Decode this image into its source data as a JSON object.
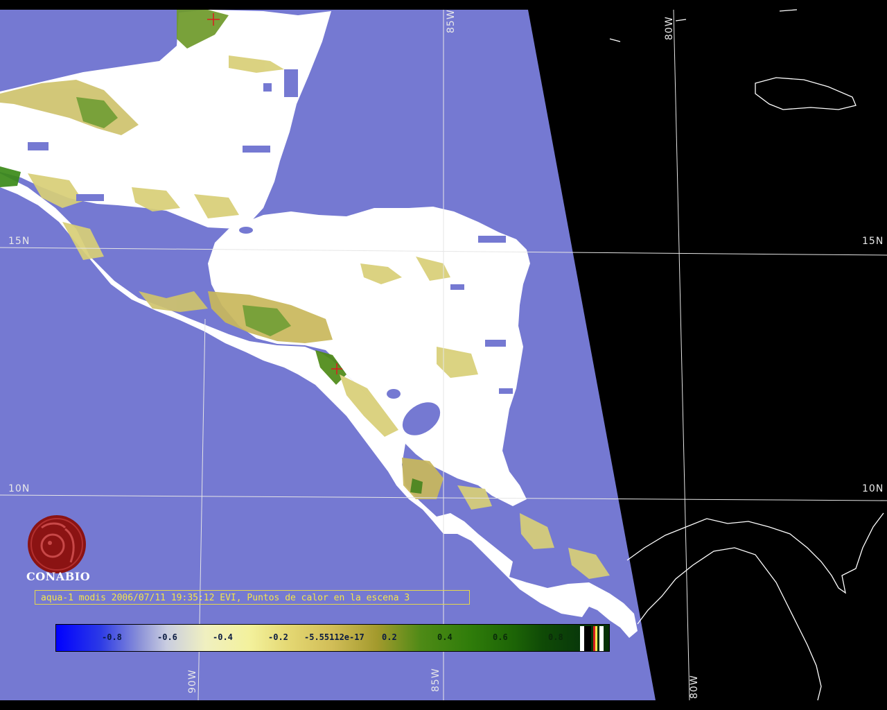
{
  "map": {
    "lat_labels": {
      "n15": "15N",
      "n10": "10N"
    },
    "lon_labels": {
      "w90": "90W",
      "w85": "85W",
      "w80": "80W"
    }
  },
  "logo": {
    "name": "CONABIO",
    "color": "#8b1313"
  },
  "caption": "aqua-1 modis 2006/07/11 19:35:12 EVI, Puntos de calor en la escena 3",
  "colorbar": {
    "ticks": [
      "-0.8",
      "-0.6",
      "-0.4",
      "-0.2",
      "-5.55112e-17",
      "0.2",
      "0.4",
      "0.6",
      "0.8"
    ]
  },
  "colors": {
    "water": "#7579d2",
    "no_data": "#000000",
    "cloud": "#ffffff",
    "vegetation_low": "#d8cf77",
    "vegetation_high": "#2b7a16",
    "grid": "#e6e6e6",
    "caption": "#f4e54a",
    "hotspot": "#d82020"
  },
  "hotspots": [
    {
      "lat": 21.3,
      "lon": -88.3
    },
    {
      "lat": 12.6,
      "lon": -86.8
    }
  ]
}
